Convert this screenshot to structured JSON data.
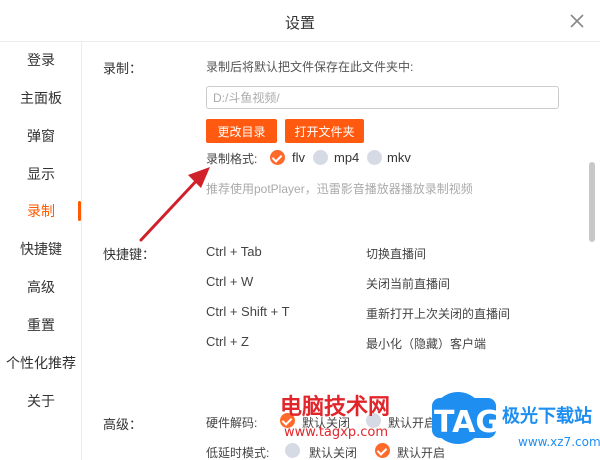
{
  "window": {
    "title": "设置",
    "close_icon": "close-icon"
  },
  "sidebar": {
    "items": [
      {
        "label": "登录"
      },
      {
        "label": "主面板"
      },
      {
        "label": "弹窗"
      },
      {
        "label": "显示"
      },
      {
        "label": "录制",
        "active": true
      },
      {
        "label": "快捷键"
      },
      {
        "label": "高级"
      },
      {
        "label": "重置"
      },
      {
        "label": "个性化推荐"
      },
      {
        "label": "关于"
      }
    ],
    "accent_color": "#ff5a00"
  },
  "record": {
    "section_label": "录制：",
    "hint": "录制后将默认把文件保存在此文件夹中:",
    "path_value": "D:/斗鱼视频/",
    "change_dir_button": "更改目录",
    "open_folder_button": "打开文件夹",
    "format_label": "录制格式:",
    "formats": [
      {
        "label": "flv",
        "checked": true
      },
      {
        "label": "mp4",
        "checked": false
      },
      {
        "label": "mkv",
        "checked": false
      }
    ],
    "tip": "推荐使用potPlayer，迅雷影音播放器播放录制视频"
  },
  "hotkeys": {
    "section_label": "快捷键：",
    "rows": [
      {
        "key": "Ctrl + Tab",
        "action": "切换直播间"
      },
      {
        "key": "Ctrl + W",
        "action": "关闭当前直播间"
      },
      {
        "key": "Ctrl + Shift + T",
        "action": "重新打开上次关闭的直播间"
      },
      {
        "key": "Ctrl + Z",
        "action": "最小化（隐藏）客户端"
      }
    ]
  },
  "advanced": {
    "section_label": "高级：",
    "hw_decode_label": "硬件解码:",
    "hw_decode_off": "默认关闭",
    "hw_decode_on": "默认开启",
    "low_latency_label": "低延时模式:",
    "low_latency_off": "默认关闭",
    "low_latency_on": "默认开启"
  },
  "watermark": {
    "brand_text": "电脑技术网",
    "url": "www.tagxp.com",
    "logo_text": "TAG",
    "site_text": "极光下载站",
    "site_url": "www.xz7.com"
  },
  "colors": {
    "accent": "#ff5a0f",
    "radio_unchecked": "#d6dae4",
    "annotation_arrow": "#d0202a"
  }
}
